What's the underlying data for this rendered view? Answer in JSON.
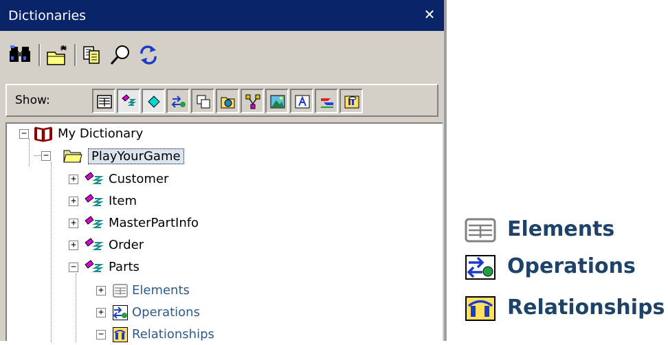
{
  "window": {
    "title": "Dictionaries",
    "close_label": "✕"
  },
  "toolbar": {
    "icons": [
      "binoculars-icon",
      "new-folder-icon",
      "copy-icon",
      "search-icon",
      "refresh-icon"
    ]
  },
  "showbar": {
    "label": "Show:",
    "filters": [
      {
        "name": "elements-filter",
        "active": false
      },
      {
        "name": "entities-filter",
        "active": true
      },
      {
        "name": "attributes-filter",
        "active": true
      },
      {
        "name": "operations-filter",
        "active": false
      },
      {
        "name": "copies-filter",
        "active": false
      },
      {
        "name": "globe-folder-filter",
        "active": false
      },
      {
        "name": "relationships-diagram-filter",
        "active": false
      },
      {
        "name": "image-filter",
        "active": false
      },
      {
        "name": "text-filter",
        "active": false
      },
      {
        "name": "links-filter",
        "active": false
      },
      {
        "name": "database-filter",
        "active": false
      }
    ]
  },
  "tree": {
    "root": "My Dictionary",
    "folder": "PlayYourGame",
    "entities": [
      "Customer",
      "Item",
      "MasterPartInfo",
      "Order",
      "Parts"
    ],
    "children": [
      "Elements",
      "Operations",
      "Relationships"
    ]
  },
  "legend": {
    "elements": "Elements",
    "operations": "Operations",
    "relationships": "Relationships"
  },
  "colors": {
    "titlebar": "#0a246a",
    "legend_text": "#1e4369",
    "entity_magenta": "#d800d8"
  }
}
